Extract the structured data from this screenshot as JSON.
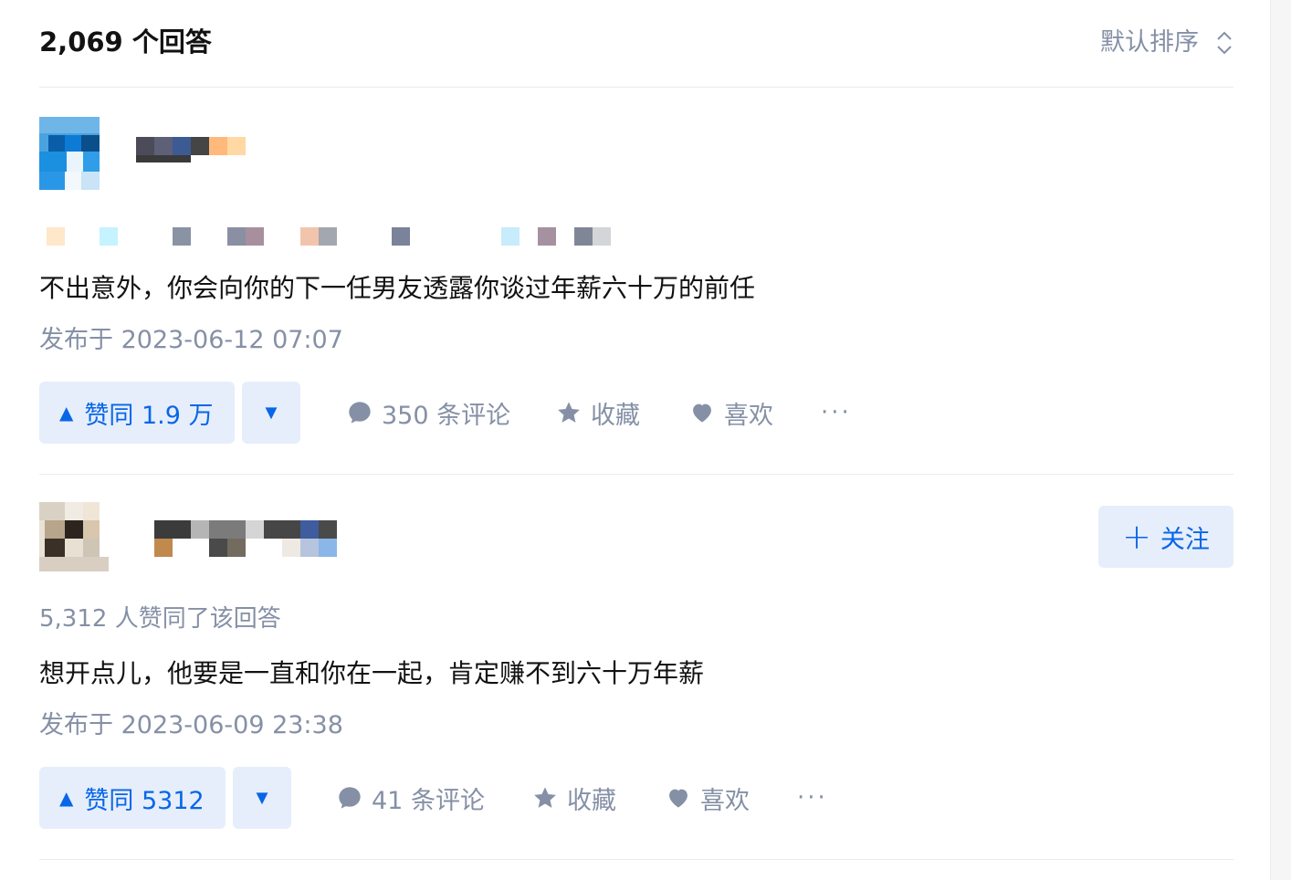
{
  "header": {
    "answer_count": "2,069 个回答",
    "sort_label": "默认排序"
  },
  "answers": [
    {
      "content": "不出意外，你会向你的下一任男友透露你谈过年薪六十万的前任",
      "date": "发布于 2023-06-12 07:07",
      "upvote_label": "赞同 1.9 万",
      "comments_label": "350 条评论",
      "favorite_label": "收藏",
      "like_label": "喜欢",
      "more_label": "···"
    },
    {
      "follow_label": "关注",
      "vote_meta": "5,312 人赞同了该回答",
      "content": "想开点儿，他要是一直和你在一起，肯定赚不到六十万年薪",
      "date": "发布于 2023-06-09 23:38",
      "upvote_label": "赞同 5312",
      "comments_label": "41 条评论",
      "favorite_label": "收藏",
      "like_label": "喜欢",
      "more_label": "···"
    }
  ],
  "colors": {
    "accent": "#0866e8",
    "accent_bg": "#e6eefb",
    "meta_gray": "#8590a6",
    "divider": "#ebebeb"
  }
}
